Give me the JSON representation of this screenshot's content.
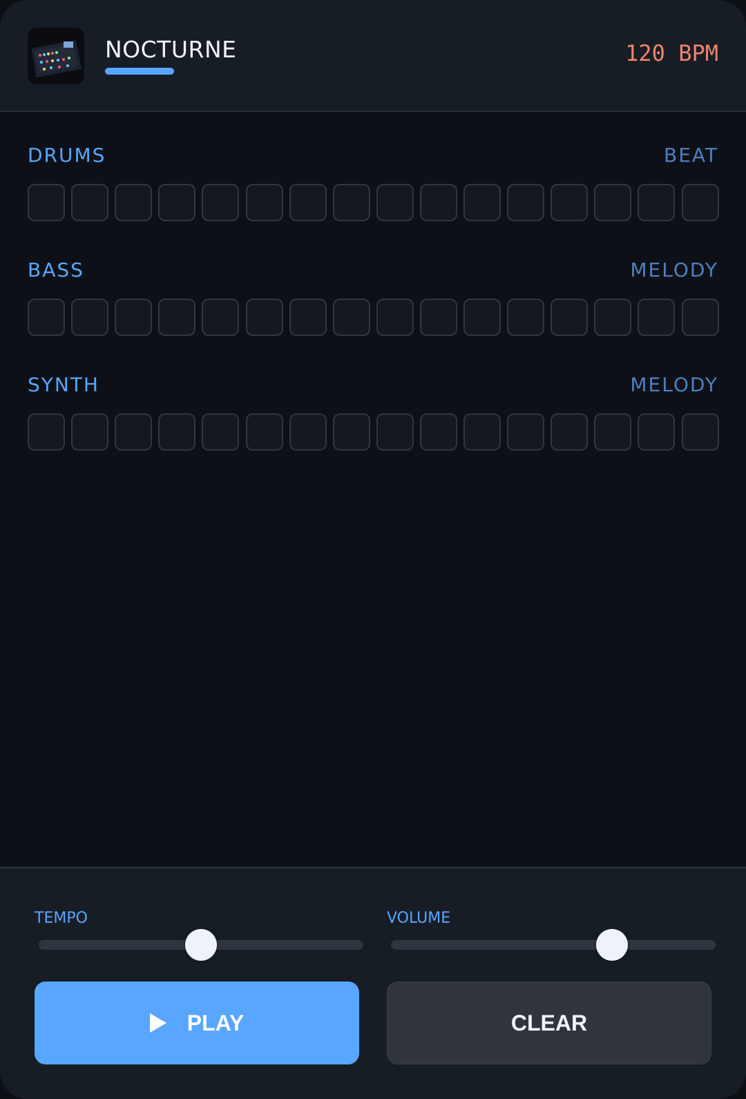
{
  "header": {
    "title": "NOCTURNE",
    "bpm": "120 BPM"
  },
  "tracks": [
    {
      "name": "DRUMS",
      "tag": "BEAT",
      "steps": 16
    },
    {
      "name": "BASS",
      "tag": "MELODY",
      "steps": 16
    },
    {
      "name": "SYNTH",
      "tag": "MELODY",
      "steps": 16
    }
  ],
  "controls": {
    "tempo_label": "TEMPO",
    "tempo_value": 0.5,
    "volume_label": "VOLUME",
    "volume_value": 0.68,
    "play_label": "PLAY",
    "clear_label": "CLEAR"
  },
  "colors": {
    "accent": "#58a6ff",
    "bpm": "#f0836b",
    "background": "#0d1117"
  }
}
